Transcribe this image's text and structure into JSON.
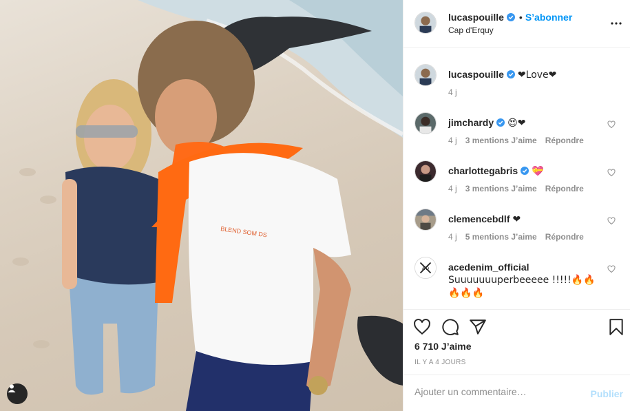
{
  "post": {
    "author": "lucaspouille",
    "follow_label": "S’abonner",
    "location": "Cap d'Erquy",
    "caption": "❤Love❤",
    "caption_age": "4 j"
  },
  "comments": [
    {
      "user": "jimchardy",
      "verified": true,
      "text": "😍❤",
      "age": "4 j",
      "likes": "3 mentions J’aime",
      "reply": "Répondre"
    },
    {
      "user": "charlottegabris",
      "verified": true,
      "text": "💝",
      "age": "4 j",
      "likes": "3 mentions J’aime",
      "reply": "Répondre"
    },
    {
      "user": "clemencebdlf",
      "verified": false,
      "text": "❤",
      "age": "4 j",
      "likes": "5 mentions J’aime",
      "reply": "Répondre"
    },
    {
      "user": "acedenim_official",
      "verified": false,
      "text": "Suuuuuuuperbeeeee !!!!!🔥🔥🔥🔥🔥",
      "age": "",
      "likes": "",
      "reply": ""
    }
  ],
  "actions": {
    "likes_count": "6 710 J’aime",
    "timestamp": "IL Y A 4 JOURS"
  },
  "composer": {
    "placeholder": "Ajouter un commentaire…",
    "publish_label": "Publier"
  },
  "icons": {
    "like": "heart-icon",
    "comment": "comment-icon",
    "share": "paper-plane-icon",
    "save": "bookmark-icon",
    "more": "more-dots-icon",
    "tag": "user-tag-icon"
  },
  "colors": {
    "accent": "#0095f6",
    "text": "#262626",
    "muted": "#8e8e8e",
    "border": "#efefef",
    "publish_disabled": "#b2dffc"
  }
}
